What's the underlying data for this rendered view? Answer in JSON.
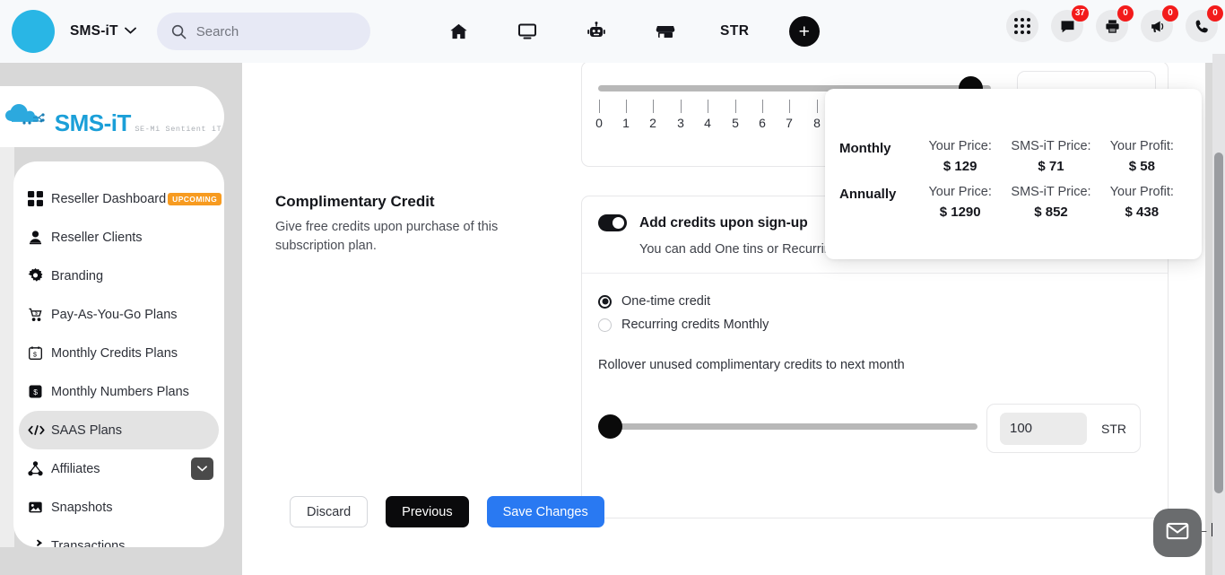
{
  "topbar": {
    "brand": "SMS-iT",
    "search_placeholder": "Search",
    "search_value": "",
    "nav_items": [
      {
        "name": "home-icon",
        "label": ""
      },
      {
        "name": "monitor-icon",
        "label": ""
      },
      {
        "name": "robot-icon",
        "label": ""
      },
      {
        "name": "store-icon",
        "label": ""
      },
      {
        "name": "str-label",
        "label": "STR"
      }
    ],
    "add_button_label": "+",
    "right_icons": [
      {
        "name": "apps-grid-icon",
        "badge": ""
      },
      {
        "name": "chat-icon",
        "badge": "37"
      },
      {
        "name": "printer-icon",
        "badge": "0"
      },
      {
        "name": "megaphone-icon",
        "badge": "0"
      },
      {
        "name": "phone-icon",
        "badge": "0"
      }
    ]
  },
  "sidebar": {
    "logo_main": "SMS-iT",
    "logo_sub": "SE-Mi Sentient iT",
    "items": [
      {
        "label": "Reseller Dashboard",
        "icon": "dashboard-grid-icon",
        "badge": "UPCOMING",
        "active": false,
        "chevron": false
      },
      {
        "label": "Reseller Clients",
        "icon": "user-icon",
        "badge": "",
        "active": false,
        "chevron": false
      },
      {
        "label": "Branding",
        "icon": "gear-icon",
        "badge": "",
        "active": false,
        "chevron": false
      },
      {
        "label": "Pay-As-You-Go Plans",
        "icon": "cart-icon",
        "badge": "",
        "active": false,
        "chevron": false
      },
      {
        "label": "Monthly Credits Plans",
        "icon": "calendar-dollar-icon",
        "badge": "",
        "active": false,
        "chevron": false
      },
      {
        "label": "Monthly Numbers Plans",
        "icon": "dollar-square-icon",
        "badge": "",
        "active": false,
        "chevron": false
      },
      {
        "label": "SAAS Plans",
        "icon": "code-icon",
        "badge": "",
        "active": true,
        "chevron": false
      },
      {
        "label": "Affiliates",
        "icon": "network-icon",
        "badge": "",
        "active": false,
        "chevron": true
      },
      {
        "label": "Snapshots",
        "icon": "image-icon",
        "badge": "",
        "active": false,
        "chevron": false
      },
      {
        "label": "Transactions",
        "icon": "transactions-icon",
        "badge": "",
        "active": false,
        "chevron": false
      }
    ],
    "collapse_label": "←"
  },
  "top_slider": {
    "ticks": [
      "0",
      "1",
      "2",
      "3",
      "4",
      "5",
      "6",
      "7",
      "8"
    ],
    "value_field": ""
  },
  "pricing": {
    "rows": [
      {
        "term": "Monthly",
        "your_price_label": "Your Price:",
        "your_price_value": "$ 129",
        "sms_price_label": "SMS-iT Price:",
        "sms_price_value": "$ 71",
        "profit_label": "Your Profit:",
        "profit_value": "$ 58"
      },
      {
        "term": "Annually",
        "your_price_label": "Your Price:",
        "your_price_value": "$ 1290",
        "sms_price_label": "SMS-iT Price:",
        "sms_price_value": "$ 852",
        "profit_label": "Your Profit:",
        "profit_value": "$ 438"
      }
    ]
  },
  "complimentary_credit": {
    "title": "Complimentary Credit",
    "description": "Give free credits upon purchase of this subscription plan.",
    "toggle_label": "Add credits upon sign-up",
    "toggle_on": true,
    "toggle_sub": "You can add One tins or Recurring credits for your clients",
    "options": [
      {
        "label": "One-time credit",
        "selected": true
      },
      {
        "label": "Recurring credits Monthly",
        "selected": false
      }
    ],
    "rollover_label": "Rollover unused complimentary credits to next month",
    "credit_value": "100",
    "credit_unit": "STR"
  },
  "footer": {
    "discard": "Discard",
    "previous": "Previous",
    "save": "Save Changes"
  },
  "colors": {
    "accent_blue": "#2979f2",
    "brand_cyan": "#29b6e5",
    "badge_red": "#f31b1b",
    "badge_orange": "#f79b20"
  }
}
